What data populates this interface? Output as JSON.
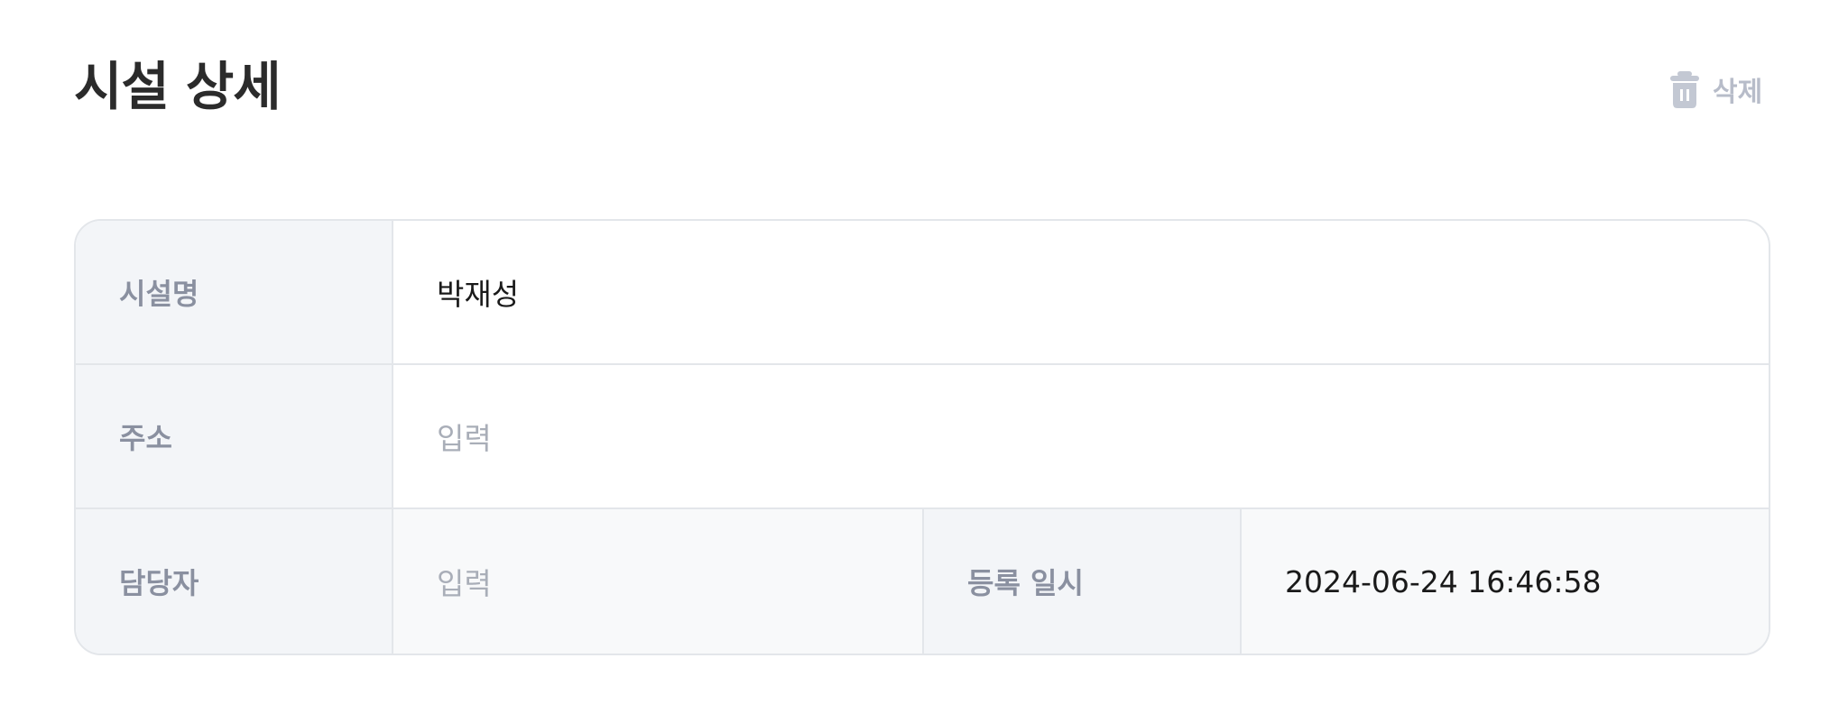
{
  "header": {
    "title": "시설 상세",
    "delete_label": "삭제"
  },
  "detail": {
    "facility_name": {
      "label": "시설명",
      "value": "박재성"
    },
    "address": {
      "label": "주소",
      "placeholder": "입력"
    },
    "manager": {
      "label": "담당자",
      "placeholder": "입력"
    },
    "registered_at": {
      "label": "등록 일시",
      "value": "2024-06-24 16:46:58"
    }
  },
  "icons": {
    "delete": "trash-icon"
  },
  "colors": {
    "title": "#2b2b2b",
    "muted_action": "#b7bcc9",
    "label_text": "#8a90a0",
    "label_background": "#f3f5f8",
    "border": "#e3e6ea",
    "placeholder": "#a9aeb8"
  }
}
